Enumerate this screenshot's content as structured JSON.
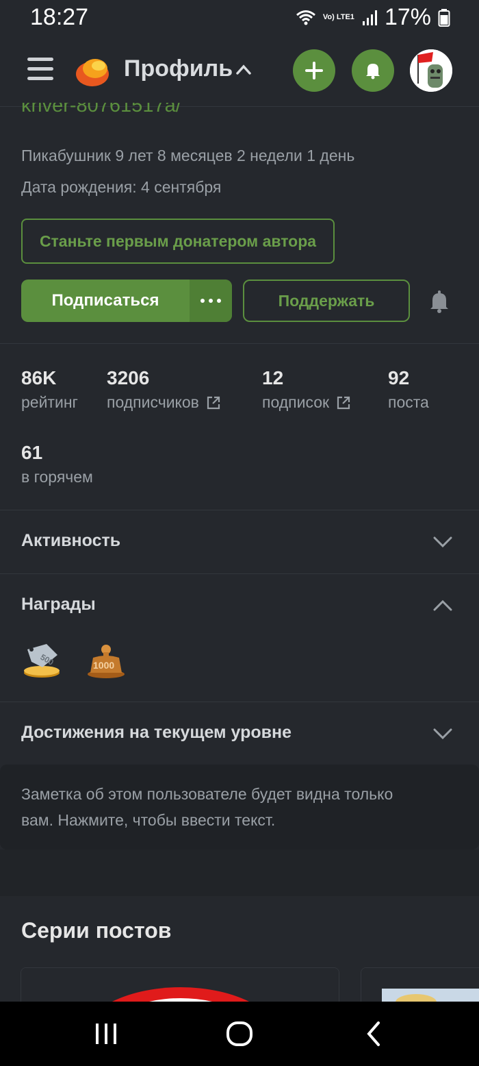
{
  "status_bar": {
    "time": "18:27",
    "network": "Vo) LTE1",
    "battery": "17%"
  },
  "app_bar": {
    "title": "Профиль"
  },
  "profile": {
    "link_partial": "kriver-80761517a/",
    "member_for": "Пикабушник 9 лет 8 месяцев 2 недели 1 день",
    "birthday": "Дата рождения: 4 сентября",
    "donate_label": "Станьте первым донатером автора",
    "subscribe_label": "Подписаться",
    "support_label": "Поддержать"
  },
  "stats": [
    {
      "value": "86K",
      "label": "рейтинг"
    },
    {
      "value": "3206",
      "label": "подписчиков"
    },
    {
      "value": "12",
      "label": "подписок"
    },
    {
      "value": "92",
      "label": "поста"
    },
    {
      "value": "61",
      "label": "в горячем"
    }
  ],
  "sections": {
    "activity": "Активность",
    "awards": "Награды",
    "achievements": "Достижения на текущем уровне"
  },
  "awards": [
    {
      "icon": "price-tag-500-award-icon",
      "label": "500"
    },
    {
      "icon": "weight-1000-award-icon",
      "label": "1000"
    }
  ],
  "note": {
    "text": "Заметка об этом пользователе будет видна только вам. Нажмите, чтобы ввести текст."
  },
  "series": {
    "title": "Серии постов"
  },
  "colors": {
    "background": "#25282d",
    "accent": "#5b8f3e",
    "muted_text": "#9aa0a6"
  }
}
